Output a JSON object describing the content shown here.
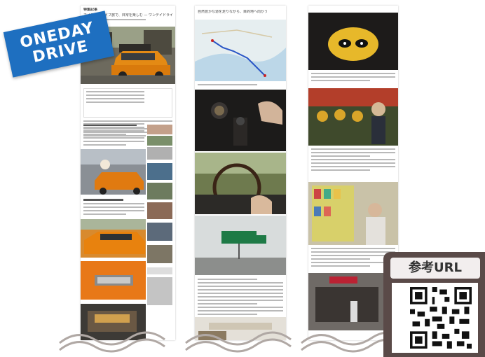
{
  "banner": {
    "line1": "ONEDAY",
    "line2": "DRIVE"
  },
  "qr": {
    "title": "参考URL"
  },
  "article1": {
    "section_label": "特集記事",
    "headline": "カメラとドライブ旅で、日常を楽しむ — ワンデイドライブ",
    "section_heading": "ワンデイドライブ"
  },
  "article2": {
    "headline": "自然豊かな道を走りながら、目的地へ向かう"
  },
  "colors": {
    "banner_blue": "#1e6fc0",
    "qr_panel": "#5a4a48",
    "wave": "#b0a8a4"
  }
}
